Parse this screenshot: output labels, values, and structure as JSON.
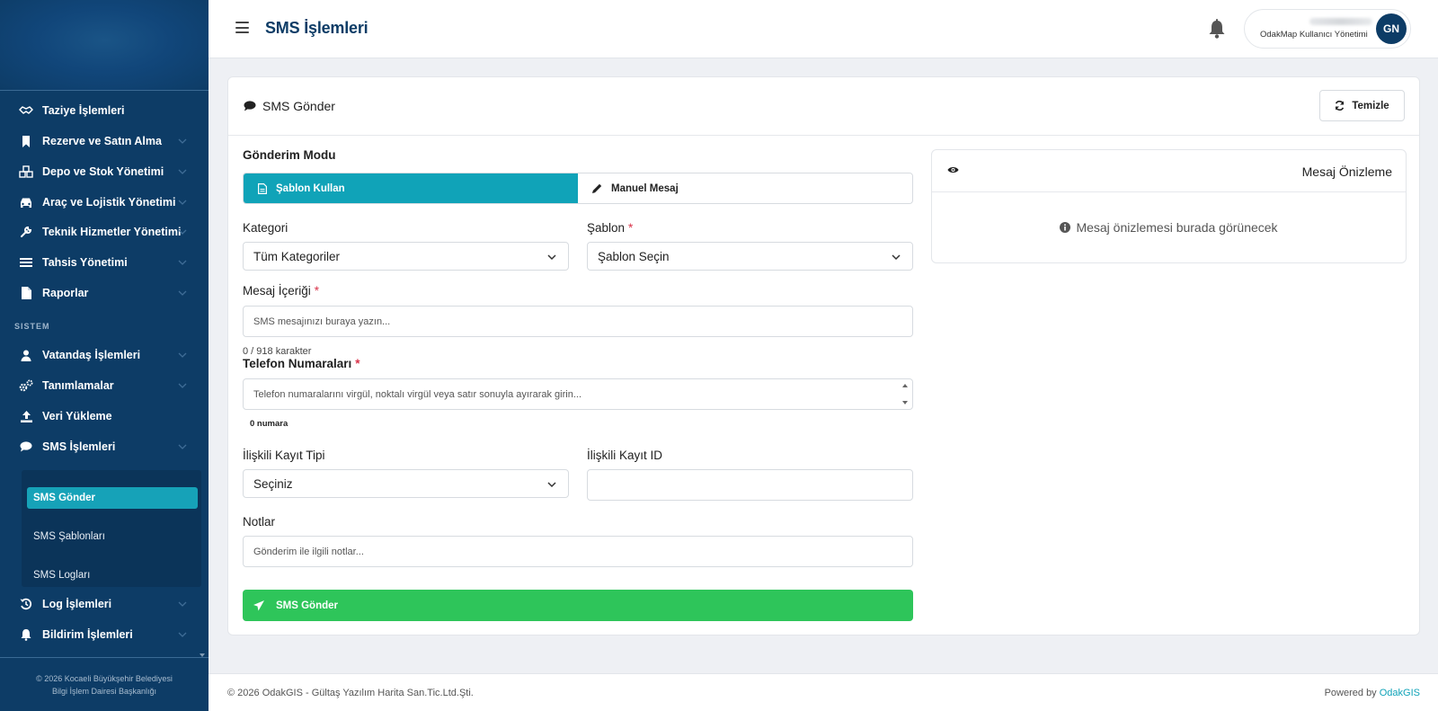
{
  "sidebar": {
    "items": [
      {
        "label": "Taziye İşlemleri",
        "icon": "handshake-icon"
      },
      {
        "label": "Rezerve ve Satın Alma",
        "icon": "bookmark-icon"
      },
      {
        "label": "Depo ve Stok Yönetimi",
        "icon": "cubes-icon"
      },
      {
        "label": "Araç ve Lojistik Yönetimi",
        "icon": "car-icon"
      },
      {
        "label": "Teknik Hizmetler Yönetimi",
        "icon": "wrench-icon"
      },
      {
        "label": "Tahsis Yönetimi",
        "icon": "list-icon"
      },
      {
        "label": "Raporlar",
        "icon": "file-icon"
      }
    ],
    "section_label": "SISTEM",
    "system_items": [
      {
        "label": "Vatandaş İşlemleri",
        "icon": "user-icon"
      },
      {
        "label": "Tanımlamalar",
        "icon": "cogs-icon"
      },
      {
        "label": "Veri Yükleme",
        "icon": "upload-icon"
      },
      {
        "label": "SMS İşlemleri",
        "icon": "comment-icon"
      }
    ],
    "sms_subitems": [
      "SMS Gönder",
      "SMS Şablonları",
      "SMS Logları"
    ],
    "bottom_items": [
      {
        "label": "Log İşlemleri",
        "icon": "history-icon"
      },
      {
        "label": "Bildirim İşlemleri",
        "icon": "bell-icon"
      }
    ],
    "footer_line1": "© 2026 Kocaeli Büyükşehir Belediyesi",
    "footer_line2": "Bilgi İşlem Dairesi Başkanlığı"
  },
  "header": {
    "title": "SMS İşlemleri",
    "user_role": "OdakMap Kullanıcı Yönetimi",
    "avatar_initials": "GN"
  },
  "card": {
    "title": "SMS Gönder",
    "clear_button": "Temizle",
    "send_mode_label": "Gönderim Modu",
    "mode_template": "Şablon Kullan",
    "mode_manual": "Manuel Mesaj",
    "category_label": "Kategori",
    "category_value": "Tüm Kategoriler",
    "template_label": "Şablon",
    "template_value": "Şablon Seçin",
    "message_label": "Mesaj İçeriği",
    "message_placeholder": "SMS mesajınızı buraya yazın...",
    "char_count": "0 / 918 karakter",
    "phones_label": "Telefon Numaraları",
    "phones_placeholder": "Telefon numaralarını virgül, noktalı virgül veya satır sonuyla ayırarak girin...",
    "phone_count": "0 numara",
    "related_type_label": "İlişkili Kayıt Tipi",
    "related_type_value": "Seçiniz",
    "related_id_label": "İlişkili Kayıt ID",
    "related_id_value": "",
    "notes_label": "Notlar",
    "notes_placeholder": "Gönderim ile ilgili notlar...",
    "send_button": "SMS Gönder",
    "required_mark": "*"
  },
  "preview": {
    "title": "Mesaj Önizleme",
    "empty_text": "Mesaj önizlemesi burada görünecek"
  },
  "footer": {
    "left": "© 2026 OdakGIS - Gültaş Yazılım Harita San.Tic.Ltd.Şti.",
    "right_prefix": "Powered by",
    "right_link": "OdakGIS"
  },
  "colors": {
    "sidebar_bg": "#0d3c66",
    "accent_teal": "#10a3b8",
    "send_green": "#2ec55a",
    "required_red": "#d9334a"
  }
}
